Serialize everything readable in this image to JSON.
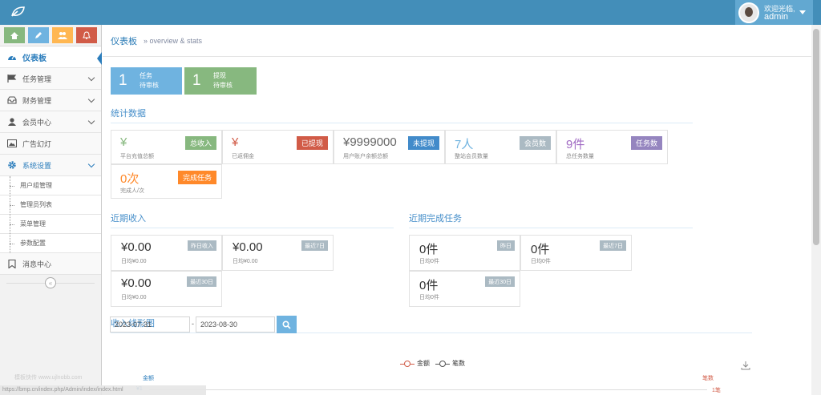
{
  "navbar": {
    "welcome_line": "欢迎光临,",
    "username": "admin"
  },
  "sidebar": {
    "items": [
      {
        "label": "仪表板"
      },
      {
        "label": "任务管理"
      },
      {
        "label": "财务管理"
      },
      {
        "label": "会员中心"
      },
      {
        "label": "广告幻灯"
      },
      {
        "label": "系统设置"
      },
      {
        "label": "消息中心"
      }
    ],
    "sub_items": [
      {
        "label": "用户组管理"
      },
      {
        "label": "管理员列表"
      },
      {
        "label": "菜单管理"
      },
      {
        "label": "参数配置"
      }
    ],
    "collapse": "«",
    "watermark": "模板快传 www.ujlnobb.com"
  },
  "breadcrumb": {
    "title": "仪表板",
    "sub": "» overview & stats"
  },
  "tiles": [
    {
      "num": "1",
      "line1": "任务",
      "line2": "待审核",
      "color": "#6fb3e0"
    },
    {
      "num": "1",
      "line1": "提现",
      "line2": "待审核",
      "color": "#87b87f"
    }
  ],
  "stats": {
    "title": "统计数据",
    "cards": [
      {
        "value": "¥",
        "desc": "平台充值总额",
        "badge": "总收入",
        "value_color": "#87b87f",
        "badge_color": "#87b87f"
      },
      {
        "value": "¥",
        "desc": "已返佣金",
        "badge": "已提现",
        "value_color": "#d15b47",
        "badge_color": "#d15b47"
      },
      {
        "value": "¥9999000",
        "desc": "用户账户余额总额",
        "badge": "未提现",
        "value_color": "#666666",
        "badge_color": "#428bca"
      },
      {
        "value": "7人",
        "desc": "整站会员数量",
        "badge": "会员数",
        "value_color": "#6fb3e0",
        "badge_color": "#abbac3"
      },
      {
        "value": "9件",
        "desc": "总任务数量",
        "badge": "任务数",
        "value_color": "#a069c3",
        "badge_color": "#9585bf"
      },
      {
        "value": "0次",
        "desc": "完成人/次",
        "badge": "完成任务",
        "value_color": "#ff892a",
        "badge_color": "#ff892a"
      }
    ]
  },
  "income": {
    "title": "近期收入",
    "cards": [
      {
        "value": "¥0.00",
        "desc": "日均¥0.00",
        "badge": "昨日收入"
      },
      {
        "value": "¥0.00",
        "desc": "日均¥0.00",
        "badge": "最近7日"
      },
      {
        "value": "¥0.00",
        "desc": "日均¥0.00",
        "badge": "最近30日"
      }
    ]
  },
  "tasks": {
    "title": "近期完成任务",
    "cards": [
      {
        "value": "0件",
        "desc": "日均0件",
        "badge": "昨日"
      },
      {
        "value": "0件",
        "desc": "日均0件",
        "badge": "最近7日"
      },
      {
        "value": "0件",
        "desc": "日均0件",
        "badge": "最近30日"
      }
    ]
  },
  "chart": {
    "title": "收入线形图",
    "date_from": "2023-07-31",
    "date_sep": "-",
    "date_to": "2023-08-30",
    "legend_amount": "金额",
    "legend_count": "笔数",
    "y_left_label": "金额",
    "y_right_label": "笔数",
    "y_left_tick": "¥1",
    "y_right_tick": "1笔",
    "amount_color": "#d15b47",
    "count_color": "#555555"
  },
  "status_bar": "https://bmp.cn/index.php/Admin/index/index.html"
}
